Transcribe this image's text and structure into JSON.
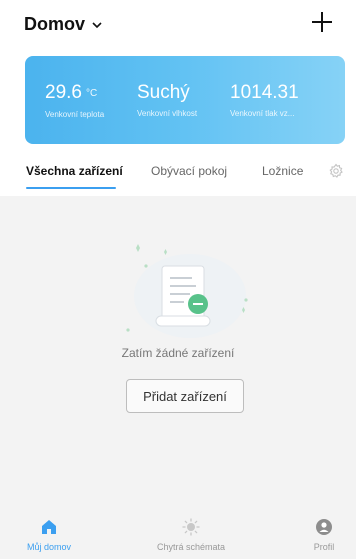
{
  "header": {
    "home_name": "Domov"
  },
  "weather": {
    "temperature": {
      "value": "29.6",
      "unit": "°C",
      "label": "Venkovní teplota"
    },
    "humidity": {
      "value": "Suchý",
      "label": "Venkovní vlhkost"
    },
    "pressure": {
      "value": "1014.31",
      "label": "Venkovní tlak vz..."
    }
  },
  "tabs": [
    {
      "label": "Všechna zařízení",
      "active": true
    },
    {
      "label": "Obývací pokoj",
      "active": false
    },
    {
      "label": "Ložnice",
      "active": false
    }
  ],
  "empty_state": {
    "text": "Zatím žádné zařízení",
    "button_label": "Přidat zařízení"
  },
  "bottom_nav": [
    {
      "label": "Můj domov",
      "icon": "home-icon",
      "active": true
    },
    {
      "label": "Chytrá schémata",
      "icon": "sun-icon",
      "active": false
    },
    {
      "label": "Profil",
      "icon": "user-icon",
      "active": false
    }
  ],
  "colors": {
    "accent": "#3b9ff0",
    "weather_card": "#5bbcf1",
    "background": "#f3f3f3"
  }
}
